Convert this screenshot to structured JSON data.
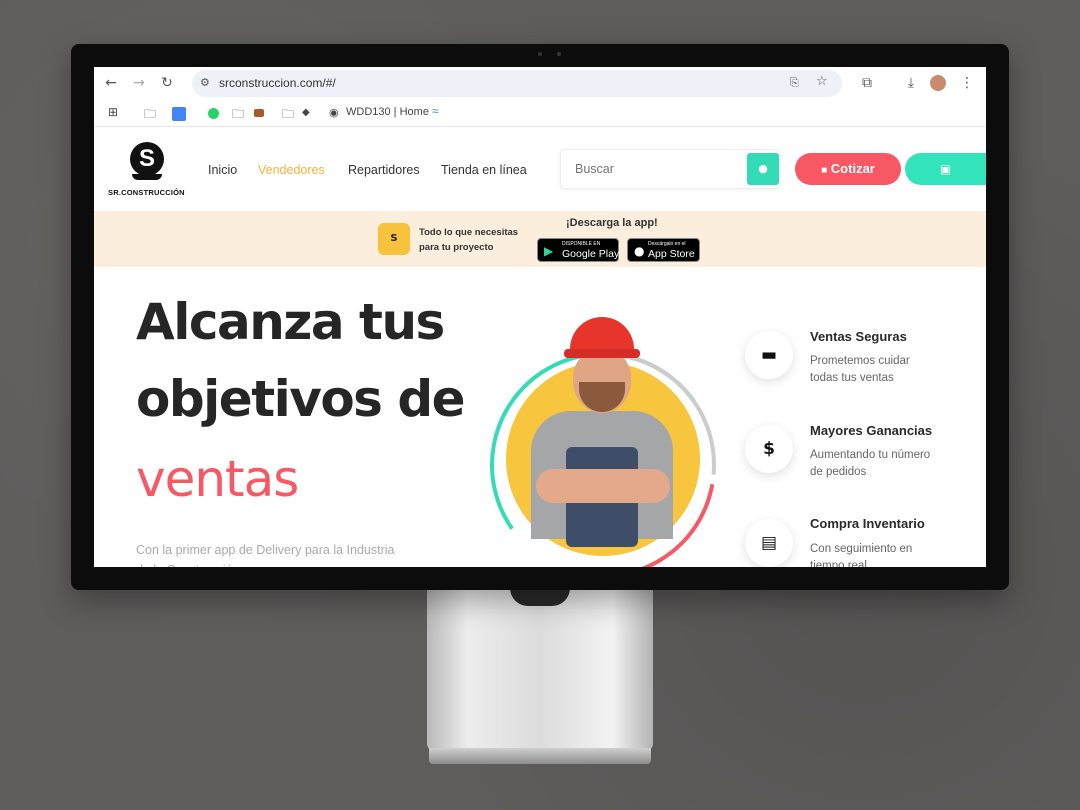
{
  "browser": {
    "url": "srconstruccion.com/#/",
    "bookmarks": [
      "WDD130 | Home"
    ]
  },
  "site": {
    "logo_text": "SR.CONSTRUCCIÓN",
    "nav": [
      "Inicio",
      "Vendedores",
      "Repartidores",
      "Tienda en línea"
    ],
    "search_placeholder": "Buscar",
    "cotizar_label": "Cotizar"
  },
  "banner": {
    "tagline": "Todo lo que necesitas para tu proyecto",
    "title": "¡Descarga la app!",
    "google_small": "DISPONIBLE EN",
    "google_big": "Google Play",
    "apple_small": "Descárgalo en el",
    "apple_big": "App Store"
  },
  "hero": {
    "line1": "Alcanza tus",
    "line2": "objetivos de",
    "line3": "ventas",
    "subtitle": "Con la primer app de Delivery para la Industria de la Construcción"
  },
  "features": [
    {
      "title": "Ventas Seguras",
      "desc": "Prometemos cuidar todas tus ventas",
      "icon": "lock-icon"
    },
    {
      "title": "Mayores Ganancias",
      "desc": "Aumentando tu número de pedidos",
      "icon": "dollar-icon"
    },
    {
      "title": "Compra Inventario",
      "desc": "Con seguimiento en tiempo real",
      "icon": "inbox-icon"
    }
  ],
  "colors": {
    "accent_yellow": "#f7b33b",
    "accent_red": "#f75864",
    "accent_teal": "#33dcb7",
    "banner_bg": "#fbeedd"
  }
}
